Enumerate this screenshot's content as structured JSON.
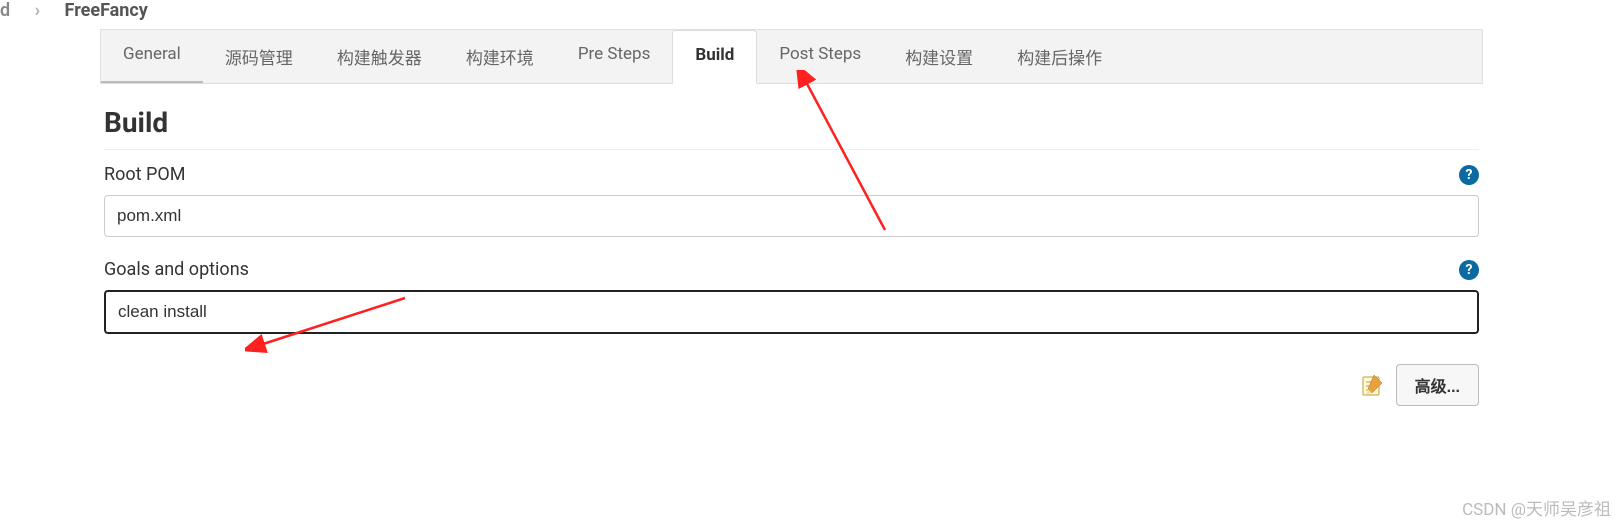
{
  "breadcrumb": {
    "prefix_fragment": "d",
    "separator": "›",
    "current": "FreeFancy"
  },
  "tabs": [
    {
      "label": "General",
      "active": false
    },
    {
      "label": "源码管理",
      "active": false
    },
    {
      "label": "构建触发器",
      "active": false
    },
    {
      "label": "构建环境",
      "active": false
    },
    {
      "label": "Pre Steps",
      "active": false
    },
    {
      "label": "Build",
      "active": true
    },
    {
      "label": "Post Steps",
      "active": false
    },
    {
      "label": "构建设置",
      "active": false
    },
    {
      "label": "构建后操作",
      "active": false
    }
  ],
  "section": {
    "title": "Build",
    "fields": {
      "root_pom": {
        "label": "Root POM",
        "value": "pom.xml",
        "help": "?"
      },
      "goals": {
        "label": "Goals and options",
        "value": "clean install",
        "help": "?"
      }
    },
    "advanced_button": "高级..."
  },
  "watermark": "CSDN @天师吴彦祖"
}
